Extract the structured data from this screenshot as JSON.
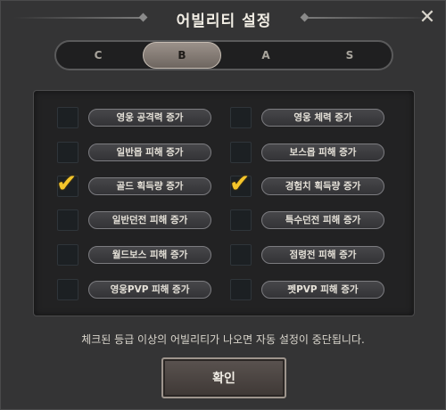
{
  "header": {
    "title": "어빌리티 설정",
    "close_glyph": "✕"
  },
  "tabs": [
    {
      "label": "C",
      "active": false
    },
    {
      "label": "B",
      "active": true
    },
    {
      "label": "A",
      "active": false
    },
    {
      "label": "S",
      "active": false
    }
  ],
  "options": [
    {
      "label": "영웅 공격력 증가",
      "checked": false
    },
    {
      "label": "영웅 체력 증가",
      "checked": false
    },
    {
      "label": "일반몹 피해 증가",
      "checked": false
    },
    {
      "label": "보스몹 피해 증가",
      "checked": false
    },
    {
      "label": "골드 획득량 증가",
      "checked": true
    },
    {
      "label": "경험치 획득량 증가",
      "checked": true
    },
    {
      "label": "일반던전 피해 증가",
      "checked": false
    },
    {
      "label": "특수던전 피해 증가",
      "checked": false
    },
    {
      "label": "월드보스 피해 증가",
      "checked": false
    },
    {
      "label": "점령전 피해 증가",
      "checked": false
    },
    {
      "label": "영웅PVP 피해 증가",
      "checked": false
    },
    {
      "label": "펫PVP 피해 증가",
      "checked": false
    }
  ],
  "footer": {
    "notice": "체크된 등급 이상의 어빌리티가 나오면 자동 설정이 중단됩니다.",
    "confirm_label": "확인"
  },
  "colors": {
    "check": "#f4c52b",
    "active_tab": "#8a817a",
    "panel_bg": "#222223"
  }
}
